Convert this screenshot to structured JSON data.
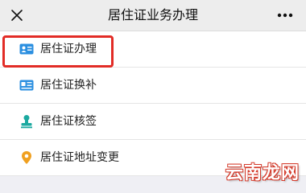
{
  "header": {
    "title": "居住证业务办理",
    "close_icon": "close-icon",
    "more_icon": "more-dots-icon"
  },
  "menu": {
    "items": [
      {
        "label": "居住证办理",
        "icon": "id-card-icon",
        "highlighted": true
      },
      {
        "label": "居住证换补",
        "icon": "card-swap-icon",
        "highlighted": false
      },
      {
        "label": "居住证核签",
        "icon": "stamp-icon",
        "highlighted": false
      },
      {
        "label": "居住证地址变更",
        "icon": "location-pin-icon",
        "highlighted": false
      }
    ]
  },
  "watermark": {
    "text": "云南龙网"
  },
  "colors": {
    "highlight_border": "#e22c26",
    "icon_blue": "#2b8fe0",
    "icon_teal": "#1ba9a0",
    "icon_orange": "#f0a020"
  }
}
